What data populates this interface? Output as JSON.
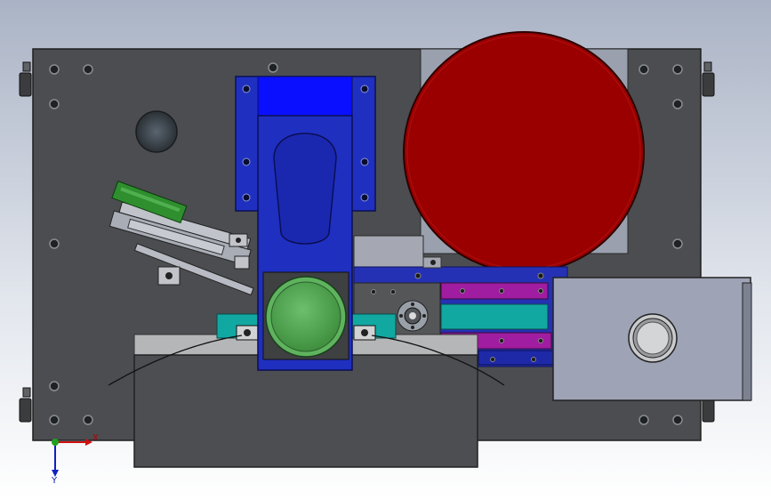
{
  "viewport": {
    "background_top": "#aeb7c8",
    "background_bottom": "#ffffff"
  },
  "colors": {
    "base_plate": "#4a4c4f",
    "blue_bracket": "#1f2fc0",
    "blue_bright": "#0a12ff",
    "red_disc": "#9c0000",
    "green_button": "#57a857",
    "green_pcb": "#2f8f2f",
    "purple_rail": "#a020a0",
    "teal_rail": "#10a8a0",
    "grey_box": "#9ea3b5",
    "light_block": "#b7b7b7",
    "dark_block": "#4e4e50"
  },
  "triad": {
    "x_label": "X",
    "y_label": "Y"
  }
}
